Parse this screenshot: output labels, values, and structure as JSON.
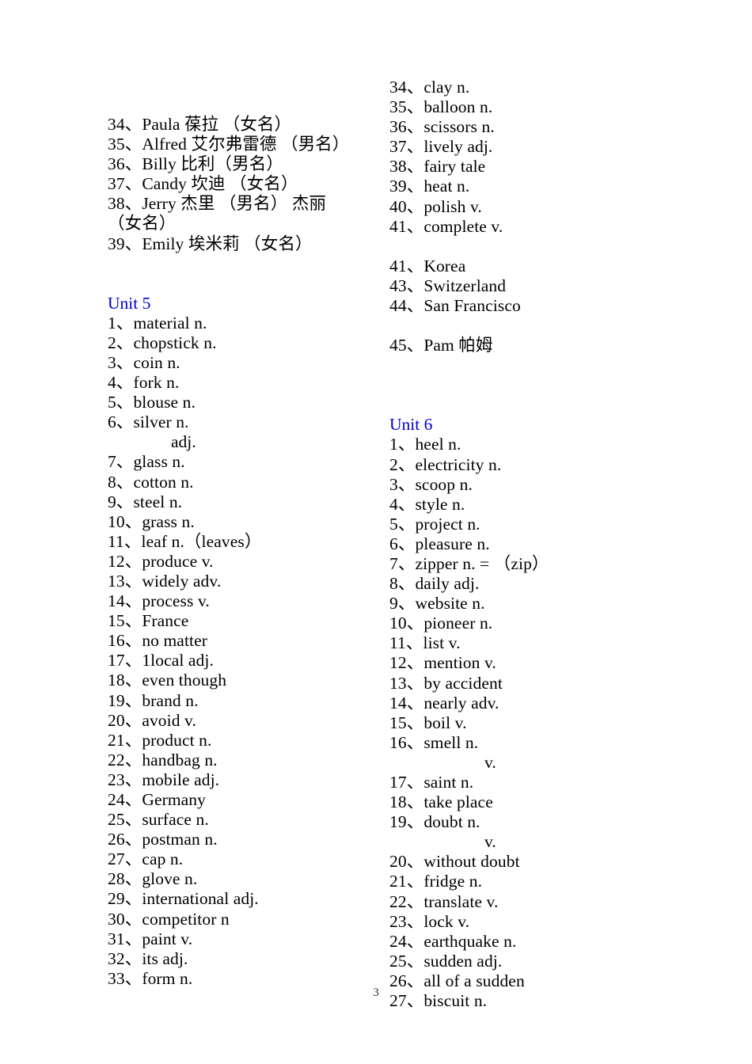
{
  "document": {
    "page_number": "3",
    "heading_color": "#0000cc",
    "text_color": "#000000"
  },
  "left_column": {
    "top_block": {
      "items": [
        {
          "num": "34、",
          "term": "Paula  葆拉 （女名）"
        },
        {
          "num": "35、",
          "term": "Alfred 艾尔弗雷德 （男名）"
        },
        {
          "num": "36、",
          "term": "Billy  比利（男名）"
        },
        {
          "num": "37、",
          "term": "Candy  坎迪 （女名）"
        },
        {
          "num": "38、",
          "term": "Jerry 杰里 （男名） 杰丽（女名）"
        },
        {
          "num": "39、",
          "term": "Emily 埃米莉 （女名）"
        }
      ]
    },
    "unit5": {
      "heading": "Unit 5",
      "items": [
        {
          "num": "1、",
          "term": "material  n."
        },
        {
          "num": "2、",
          "term": "chopstick  n."
        },
        {
          "num": "3、",
          "term": "coin  n."
        },
        {
          "num": "4、",
          "term": "fork  n."
        },
        {
          "num": "5、",
          "term": "blouse  n."
        },
        {
          "num": "6、",
          "term": "silver  n."
        },
        {
          "num": "",
          "term": "adj.",
          "sub": true,
          "indent": 80
        },
        {
          "num": "7、",
          "term": "glass  n."
        },
        {
          "num": "8、",
          "term": "cotton  n."
        },
        {
          "num": "9、",
          "term": "steel  n."
        },
        {
          "num": "10、",
          "term": "grass  n."
        },
        {
          "num": "11、",
          "term": "leaf  n.（leaves）"
        },
        {
          "num": "12、",
          "term": "produce  v."
        },
        {
          "num": "13、",
          "term": "widely  adv."
        },
        {
          "num": "14、",
          "term": "process  v."
        },
        {
          "num": "15、",
          "term": "France"
        },
        {
          "num": "16、",
          "term": "no matter"
        },
        {
          "num": "17、",
          "term": "1local  adj."
        },
        {
          "num": "18、",
          "term": "even though"
        },
        {
          "num": "19、",
          "term": "brand  n."
        },
        {
          "num": "20、",
          "term": "avoid  v."
        },
        {
          "num": "21、",
          "term": "product  n."
        },
        {
          "num": "22、",
          "term": "handbag  n."
        },
        {
          "num": "23、",
          "term": "mobile  adj."
        },
        {
          "num": "24、",
          "term": "Germany"
        },
        {
          "num": "25、",
          "term": "surface  n."
        },
        {
          "num": "26、",
          "term": "postman  n."
        },
        {
          "num": "27、",
          "term": "cap  n."
        },
        {
          "num": "28、",
          "term": "glove  n."
        },
        {
          "num": "29、",
          "term": "international  adj."
        },
        {
          "num": "30、",
          "term": "competitor  n"
        },
        {
          "num": "31、",
          "term": "paint  v."
        },
        {
          "num": "32、",
          "term": "its  adj."
        },
        {
          "num": "33、",
          "term": "form  n."
        }
      ]
    }
  },
  "right_column": {
    "unit5_continued": {
      "items": [
        {
          "num": "34、",
          "term": "clay  n."
        },
        {
          "num": "35、",
          "term": "balloon  n."
        },
        {
          "num": "36、",
          "term": "scissors  n."
        },
        {
          "num": "37、",
          "term": "lively  adj."
        },
        {
          "num": "38、",
          "term": "fairy tale"
        },
        {
          "num": "39、",
          "term": "heat  n."
        },
        {
          "num": "40、",
          "term": "polish  v."
        },
        {
          "num": "41、",
          "term": "complete  v."
        }
      ],
      "places": [
        {
          "num": "41、",
          "term": "Korea"
        },
        {
          "num": "43、",
          "term": "Switzerland"
        },
        {
          "num": "44、",
          "term": "San Francisco"
        }
      ],
      "names": [
        {
          "num": "45、",
          "term": "Pam  帕姆"
        }
      ]
    },
    "unit6": {
      "heading": "Unit 6",
      "items": [
        {
          "num": "1、",
          "term": "heel  n."
        },
        {
          "num": "2、",
          "term": "electricity  n."
        },
        {
          "num": "3、",
          "term": "scoop  n."
        },
        {
          "num": "4、",
          "term": "style  n."
        },
        {
          "num": "5、",
          "term": "project  n."
        },
        {
          "num": "6、",
          "term": "pleasure  n."
        },
        {
          "num": "7、",
          "term": "zipper  n. = （zip）"
        },
        {
          "num": "8、",
          "term": "daily  adj."
        },
        {
          "num": "9、",
          "term": "website  n."
        },
        {
          "num": "10、",
          "term": "pioneer  n."
        },
        {
          "num": "11、",
          "term": "list  v."
        },
        {
          "num": "12、",
          "term": "mention  v."
        },
        {
          "num": "13、",
          "term": "by accident"
        },
        {
          "num": "14、",
          "term": "nearly  adv."
        },
        {
          "num": "15、",
          "term": "boil v."
        },
        {
          "num": "16、",
          "term": "smell  n."
        },
        {
          "num": "",
          "term": "v.",
          "sub": true,
          "indent": 120
        },
        {
          "num": "17、",
          "term": "saint  n."
        },
        {
          "num": "18、",
          "term": "take place"
        },
        {
          "num": "19、",
          "term": "doubt  n."
        },
        {
          "num": "",
          "term": "v.",
          "sub": true,
          "indent": 120
        },
        {
          "num": "20、",
          "term": "without doubt"
        },
        {
          "num": "21、",
          "term": "fridge  n."
        },
        {
          "num": "22、",
          "term": "translate  v."
        },
        {
          "num": "23、",
          "term": "lock  v."
        },
        {
          "num": "24、",
          "term": "earthquake  n."
        },
        {
          "num": "25、",
          "term": "sudden  adj."
        },
        {
          "num": "26、",
          "term": "all of a sudden"
        },
        {
          "num": "27、",
          "term": "biscuit  n."
        }
      ]
    }
  }
}
